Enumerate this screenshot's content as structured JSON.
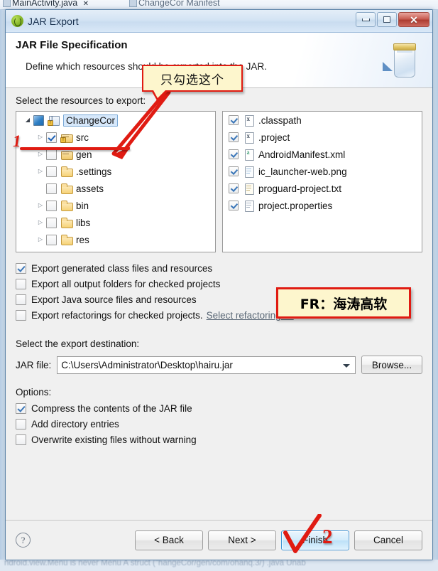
{
  "background": {
    "tabs": [
      {
        "label": "MainActivity.java",
        "active": true,
        "close": "✕"
      },
      {
        "label": "ChangeCor Manifest",
        "active": false
      }
    ],
    "status_text": "ndroid.view.Menu is never     Menu A struct     (\"hangeCor/gen/com/ohanq.3/)                 .java  Unab"
  },
  "window": {
    "title": "JAR Export",
    "icon": "jar-export-icon",
    "minimize_label": "Minimize",
    "maximize_label": "Maximize",
    "close_label": "Close"
  },
  "header": {
    "title": "JAR File Specification",
    "description": "Define which resources should be exported into the JAR.",
    "banner_icon": "jar-bottle-icon"
  },
  "resources": {
    "label": "Select the resources to export:",
    "tree": [
      {
        "name": "ChangeCor",
        "state": "blue",
        "twisty": "open",
        "icon": "java-project-icon",
        "indent": 0,
        "selected": true,
        "warn": true
      },
      {
        "name": "src",
        "state": "checked",
        "twisty": "closed",
        "icon": "package-folder-icon",
        "indent": 1,
        "selected": false,
        "warn": true
      },
      {
        "name": "gen",
        "state": "unchecked",
        "twisty": "closed",
        "icon": "package-folder-icon",
        "indent": 1,
        "selected": false,
        "warn": false
      },
      {
        "name": ".settings",
        "state": "unchecked",
        "twisty": "closed",
        "icon": "folder-icon",
        "indent": 1,
        "selected": false,
        "warn": false
      },
      {
        "name": "assets",
        "state": "unchecked",
        "twisty": "none",
        "icon": "folder-icon",
        "indent": 1,
        "selected": false,
        "warn": false
      },
      {
        "name": "bin",
        "state": "unchecked",
        "twisty": "closed",
        "icon": "folder-icon",
        "indent": 1,
        "selected": false,
        "warn": false
      },
      {
        "name": "libs",
        "state": "unchecked",
        "twisty": "closed",
        "icon": "folder-icon",
        "indent": 1,
        "selected": false,
        "warn": false
      },
      {
        "name": "res",
        "state": "unchecked",
        "twisty": "closed",
        "icon": "folder-icon",
        "indent": 1,
        "selected": false,
        "warn": false
      }
    ],
    "files": [
      {
        "name": ".classpath",
        "checked": true,
        "icon": "xml-file-icon"
      },
      {
        "name": ".project",
        "checked": true,
        "icon": "xml-file-icon"
      },
      {
        "name": "AndroidManifest.xml",
        "checked": true,
        "icon": "android-manifest-icon"
      },
      {
        "name": "ic_launcher-web.png",
        "checked": true,
        "icon": "png-file-icon"
      },
      {
        "name": "proguard-project.txt",
        "checked": true,
        "icon": "txt-file-icon"
      },
      {
        "name": "project.properties",
        "checked": true,
        "icon": "properties-file-icon"
      }
    ]
  },
  "export_options": [
    {
      "label": "Export generated class files and resources",
      "checked": true,
      "link": null
    },
    {
      "label": "Export all output folders for checked projects",
      "checked": false,
      "link": null
    },
    {
      "label": "Export Java source files and resources",
      "checked": false,
      "link": null
    },
    {
      "label": "Export refactorings for checked projects.",
      "checked": false,
      "link": "Select refactorings..."
    }
  ],
  "destination": {
    "label": "Select the export destination:",
    "field_label": "JAR file:",
    "value": "C:\\Users\\Administrator\\Desktop\\hairu.jar",
    "placeholder": "",
    "browse_label": "Browse..."
  },
  "options": {
    "label": "Options:",
    "items": [
      {
        "label": "Compress the contents of the JAR file",
        "checked": true
      },
      {
        "label": "Add directory entries",
        "checked": false
      },
      {
        "label": "Overwrite existing files without warning",
        "checked": false
      }
    ]
  },
  "footer": {
    "help_label": "?",
    "back_label": "< Back",
    "next_label": "Next >",
    "finish_label": "Finish",
    "cancel_label": "Cancel"
  },
  "annotations": {
    "callout_text": "只勾选这个",
    "watermark_text": "FR：海涛高软",
    "step_one": "1",
    "step_two": "2",
    "accent_red": "#e01b12",
    "note_bg": "#fdf6cd",
    "default_button_blue": "#3c93d4"
  }
}
